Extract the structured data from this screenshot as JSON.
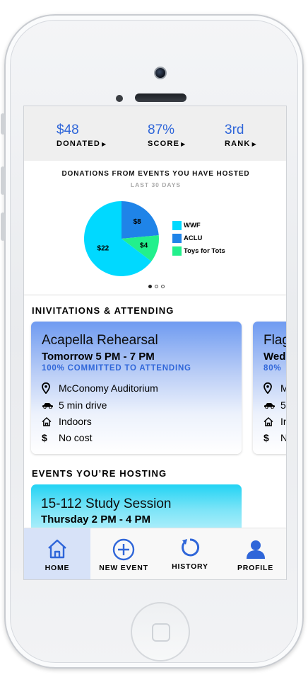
{
  "stats": [
    {
      "value": "$48",
      "label": "DONATED"
    },
    {
      "value": "87%",
      "label": "SCORE"
    },
    {
      "value": "3rd",
      "label": "RANK"
    }
  ],
  "donations": {
    "title": "DONATIONS FROM EVENTS YOU HAVE HOSTED",
    "subtitle": "LAST 30 DAYS"
  },
  "chart_data": {
    "type": "pie",
    "categories": [
      "WWF",
      "ACLU",
      "Toys for Tots"
    ],
    "values": [
      22,
      8,
      4
    ],
    "value_labels": [
      "$22",
      "$8",
      "$4"
    ],
    "colors": [
      "#00d9ff",
      "#1f84e8",
      "#22f08c"
    ],
    "legend": "right"
  },
  "carousel": {
    "pages": 3,
    "active": 0
  },
  "invitations": {
    "heading": "INIVITATIONS & ATTENDING",
    "cards": [
      {
        "title": "Acapella Rehearsal",
        "time": "Tomorrow 5 PM - 7 PM",
        "commitment": "100% COMMITTED TO ATTENDING",
        "location": "McConomy Auditorium",
        "travel": "5 min drive",
        "setting": "Indoors",
        "cost": "No cost"
      },
      {
        "title": "Flag",
        "time": "Wed",
        "commitment": "80%",
        "location": "M",
        "travel": "5",
        "setting": "In",
        "cost": "N"
      }
    ]
  },
  "hosting": {
    "heading": "EVENTS YOU’RE HOSTING",
    "cards": [
      {
        "title": "15-112 Study Session",
        "time": "Thursday 2 PM - 4 PM"
      }
    ]
  },
  "tabs": [
    {
      "label": "HOME",
      "icon": "home-icon",
      "active": true
    },
    {
      "label": "NEW EVENT",
      "icon": "plus-circle-icon",
      "active": false
    },
    {
      "label": "HISTORY",
      "icon": "history-icon",
      "active": false
    },
    {
      "label": "PROFILE",
      "icon": "person-icon",
      "active": false
    }
  ],
  "colors": {
    "accent": "#2f66d9",
    "active_tab": "#d7e2f8"
  }
}
